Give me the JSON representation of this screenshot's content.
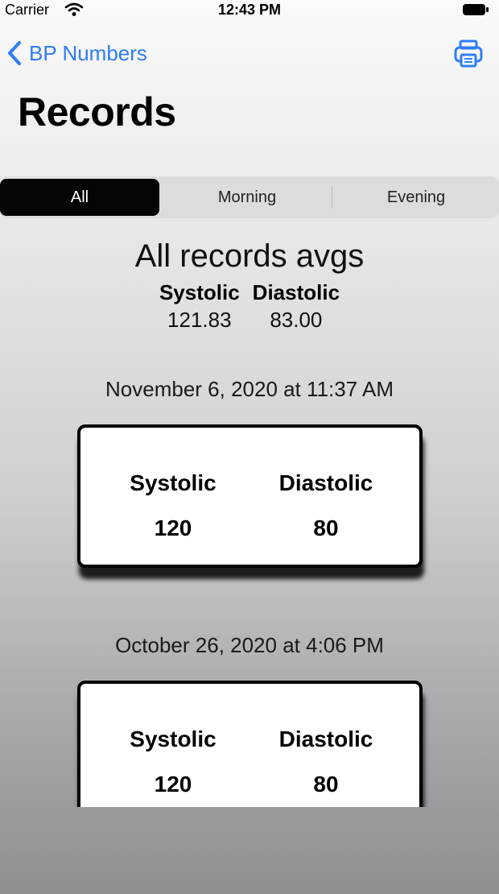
{
  "status_bar": {
    "carrier": "Carrier",
    "time": "12:43 PM"
  },
  "nav": {
    "back_label": "BP Numbers",
    "print_icon": "printer-icon"
  },
  "page_title": "Records",
  "segments": {
    "items": [
      "All",
      "Morning",
      "Evening"
    ],
    "selected": "All"
  },
  "averages": {
    "title": "All records avgs",
    "systolic_label": "Systolic",
    "diastolic_label": "Diastolic",
    "systolic_value": "121.83",
    "diastolic_value": "83.00"
  },
  "records": [
    {
      "date": "November 6, 2020 at 11:37 AM",
      "systolic_label": "Systolic",
      "diastolic_label": "Diastolic",
      "systolic": "120",
      "diastolic": "80"
    },
    {
      "date": "October 26, 2020 at 4:06 PM",
      "systolic_label": "Systolic",
      "diastolic_label": "Diastolic",
      "systolic": "120",
      "diastolic": "80"
    }
  ],
  "colors": {
    "accent": "#2f7cf6",
    "selected_segment": "#050505",
    "card_border": "#000000"
  }
}
